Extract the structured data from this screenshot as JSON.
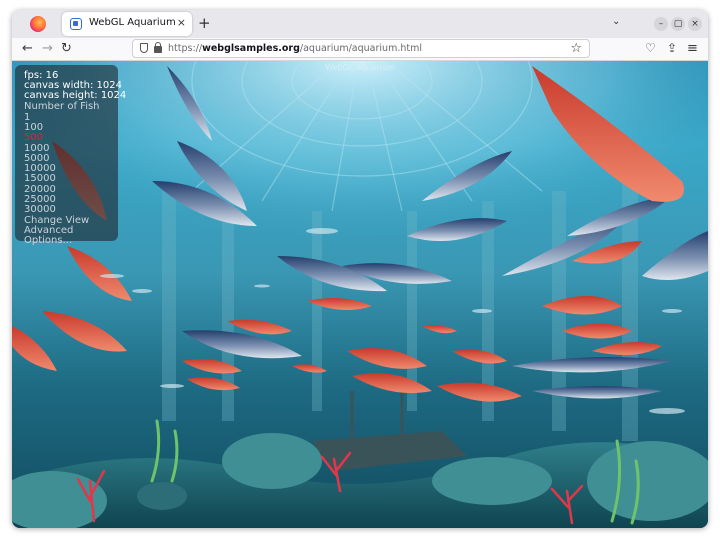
{
  "browser": {
    "tab_title": "WebGL Aquarium",
    "tab_close": "×",
    "new_tab": "+",
    "tabs_dropdown": "⌄",
    "window_buttons": {
      "minimize": "–",
      "maximize": "▢",
      "close": "×"
    },
    "nav": {
      "back": "←",
      "forward": "→",
      "reload": "↻"
    },
    "url_scheme": "https://",
    "url_host": "webglsamples.org",
    "url_path": "/aquarium/aquarium.html",
    "toolbar_icons": {
      "pocket": "♡",
      "extensions": "⇪",
      "menu": "≡"
    },
    "bookmark_star": "☆"
  },
  "page": {
    "title": "WebGL Aquarium",
    "stats": {
      "fps": "fps: 16",
      "canvas_width": "canvas width: 1024",
      "canvas_height": "canvas height: 1024"
    },
    "fish_menu": {
      "heading": "Number of Fish",
      "options": [
        "1",
        "100",
        "500",
        "1000",
        "5000",
        "10000",
        "15000",
        "20000",
        "25000",
        "30000"
      ],
      "selected": "500"
    },
    "links": {
      "change_view": "Change View",
      "advanced": "Advanced",
      "options": "Options..."
    }
  },
  "colors": {
    "selected_option": "#e0203a",
    "water_top": "#2a8fb6",
    "water_bottom": "#124b5e",
    "red_fish": "#e0523f",
    "tuna": "#3c5a8a"
  }
}
